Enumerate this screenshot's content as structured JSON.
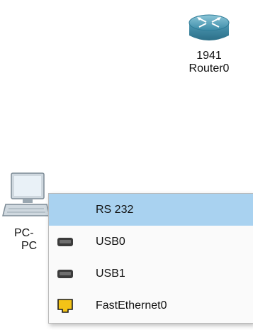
{
  "router": {
    "model": "1941",
    "name": "Router0",
    "icon": "router-icon"
  },
  "pc": {
    "name_line1": "PC-",
    "name_line2": "PC",
    "icon": "pc-icon"
  },
  "port_menu": {
    "items": [
      {
        "label": "RS 232",
        "icon": "",
        "selected": true
      },
      {
        "label": "USB0",
        "icon": "usb-port-icon",
        "selected": false
      },
      {
        "label": "USB1",
        "icon": "usb-port-icon",
        "selected": false
      },
      {
        "label": "FastEthernet0",
        "icon": "ethernet-port-icon",
        "selected": false
      }
    ]
  },
  "colors": {
    "selection": "#a9d2f0",
    "router": "#3f8fab",
    "ethernet": "#f3c317"
  }
}
